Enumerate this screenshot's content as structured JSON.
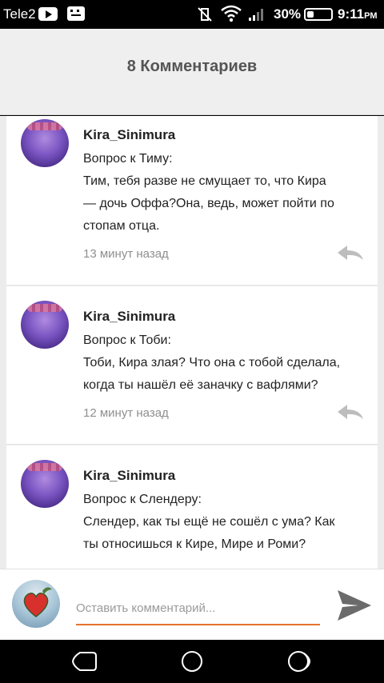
{
  "status_bar": {
    "carrier": "Tele2",
    "battery_percent": "30%",
    "time": "9:11",
    "time_suffix": "PM",
    "battery_level": 0.3
  },
  "header": {
    "title": "8 Комментариев"
  },
  "comments": [
    {
      "author": "Kira_Sinimura",
      "lines": [
        "Вопрос к Тиму:",
        "Тим, тебя разве не смущает то, что Кира",
        "— дочь Оффа?Она, ведь, может пойти по",
        "стопам отца."
      ],
      "time_ago": "13 минут назад"
    },
    {
      "author": "Kira_Sinimura",
      "lines": [
        "Вопрос к Тоби:",
        "Тоби, Кира злая? Что она с тобой сделала,",
        "когда ты нашёл её заначку с вафлями?"
      ],
      "time_ago": "12 минут назад"
    },
    {
      "author": "Kira_Sinimura",
      "lines": [
        "Вопрос к Слендеру:",
        "Слендер, как ты ещё не сошёл с ума? Как",
        "ты относишься к Кире, Мире и Роми?"
      ],
      "time_ago": ""
    }
  ],
  "input": {
    "placeholder": "Оставить комментарий..."
  },
  "colors": {
    "accent": "#e8732c",
    "header_bg": "#efefef",
    "time_text": "#8f8f8f"
  },
  "icons": {
    "reply": "reply-arrow-icon",
    "send": "send-icon",
    "nav_back": "back-icon",
    "nav_home": "home-icon",
    "nav_recent": "recent-apps-icon"
  }
}
